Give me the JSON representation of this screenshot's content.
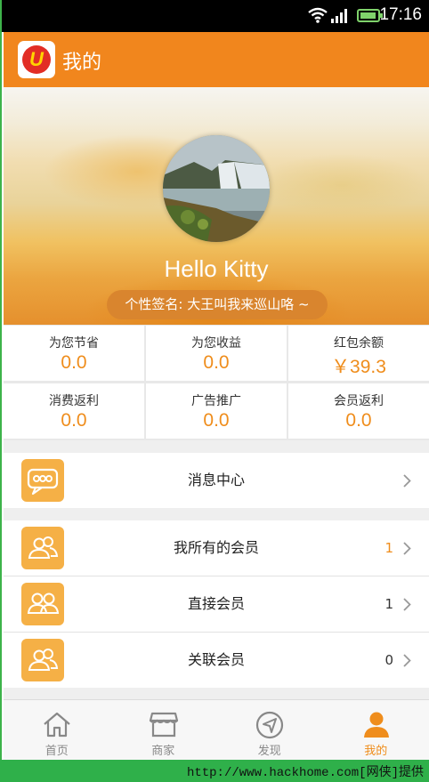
{
  "status_bar": {
    "time": "17:16"
  },
  "header": {
    "title": "我的",
    "logo_letter": "U"
  },
  "profile": {
    "name": "Hello Kitty",
    "signature": "个性签名: 大王叫我来巡山咯 ~"
  },
  "stats": [
    {
      "label": "为您节省",
      "value": "0.0"
    },
    {
      "label": "为您收益",
      "value": "0.0"
    },
    {
      "label": "红包余额",
      "value": "￥39.3"
    },
    {
      "label": "消费返利",
      "value": "0.0"
    },
    {
      "label": "广告推广",
      "value": "0.0"
    },
    {
      "label": "会员返利",
      "value": "0.0"
    }
  ],
  "menu": {
    "messages": {
      "label": "消息中心",
      "icon": "chat-bubble-icon"
    },
    "all_members": {
      "label": "我所有的会员",
      "count": "1",
      "icon": "members-icon"
    },
    "direct_members": {
      "label": "直接会员",
      "count": "1",
      "icon": "members-icon"
    },
    "related_members": {
      "label": "关联会员",
      "count": "0",
      "icon": "members-icon"
    }
  },
  "tabs": [
    {
      "label": "首页",
      "icon": "home-icon"
    },
    {
      "label": "商家",
      "icon": "shop-icon"
    },
    {
      "label": "发现",
      "icon": "compass-icon"
    },
    {
      "label": "我的",
      "icon": "user-icon",
      "active": true
    }
  ],
  "watermark": {
    "text": "http://www.hackhome.com[网侠]提供"
  },
  "colors": {
    "accent": "#f1861d",
    "value_orange": "#ef8d1c",
    "icon_tile": "#f5b046",
    "watermark_green": "#2fb04a"
  }
}
